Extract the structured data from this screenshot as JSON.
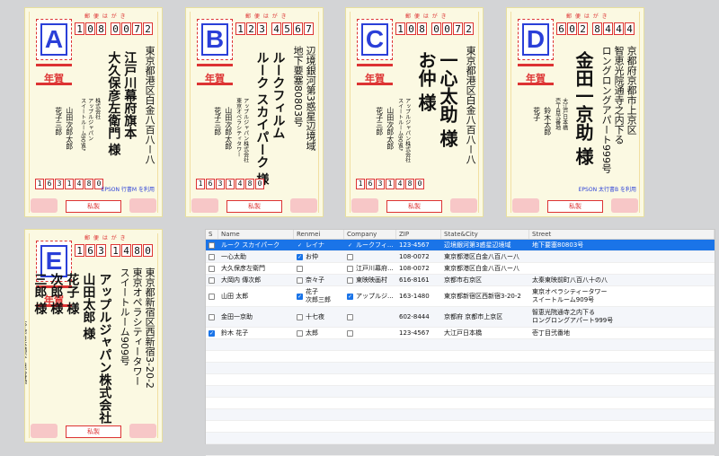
{
  "cards": [
    {
      "letter": "A",
      "zip": [
        "1",
        "0",
        "8",
        "0",
        "0",
        "7",
        "2"
      ],
      "address": [
        "東京都港区白金八百八ー八"
      ],
      "recipient": [
        "江戸川幕府旗本",
        "大久保彦左衛門 様"
      ],
      "company": [
        "株式会社",
        "アップルジャパン",
        "スイートルーム909号"
      ],
      "sender": [
        "山田",
        "花子",
        "次郎",
        "三郎",
        "太郎"
      ],
      "sender_zip": [
        "1",
        "6",
        "3",
        "1",
        "4",
        "8",
        "0"
      ],
      "note": "EPSON 行書M を利用"
    },
    {
      "letter": "B",
      "zip": [
        "1",
        "2",
        "3",
        "4",
        "5",
        "6",
        "7"
      ],
      "address": [
        "辺境銀河第3惑星辺境域",
        "地下要塞80803号"
      ],
      "recipient": [
        "ルークフィルム",
        "ルーク スカイパーク 様"
      ],
      "company": [
        "アップルジャパン株式会社",
        "東京オペラシティタワー"
      ],
      "sender": [
        "山田",
        "花子",
        "次郎",
        "三郎",
        "太郎"
      ],
      "sender_zip": [
        "1",
        "6",
        "3",
        "1",
        "4",
        "8",
        "0"
      ],
      "note": ""
    },
    {
      "letter": "C",
      "zip": [
        "1",
        "0",
        "8",
        "0",
        "0",
        "7",
        "2"
      ],
      "address": [
        "東京都港区白金八百八ー八"
      ],
      "recipient": [
        "一心太助 様",
        "お仲 様"
      ],
      "company": [
        "アップルジャパン株式会社",
        "スイートルーム909号"
      ],
      "sender": [
        "山田",
        "花子",
        "次郎",
        "三郎",
        "太郎"
      ],
      "sender_zip": [
        "1",
        "6",
        "3",
        "1",
        "4",
        "8",
        "0"
      ],
      "note": ""
    },
    {
      "letter": "D",
      "zip": [
        "6",
        "0",
        "2",
        "8",
        "4",
        "4",
        "4"
      ],
      "address": [
        "京都府京都市上京区",
        "智恵光院通寺之内下る",
        "ロングロングアパート999号"
      ],
      "recipient": [
        "金田一京助 様"
      ],
      "company": [
        "大江戸日本橋",
        "壱丁目弐番地"
      ],
      "sender": [
        "鈴木",
        "花子",
        "太郎"
      ],
      "sender_zip": [],
      "note": "EPSON 太行書B を利用"
    },
    {
      "letter": "E",
      "zip": [
        "1",
        "6",
        "3",
        "1",
        "4",
        "8",
        "0"
      ],
      "address": [
        "東京都新宿区西新宿3-20-2",
        "東京オペラシティータワー",
        "スイートルーム909号"
      ],
      "recipient": [
        "アップルジャパン株式会社",
        "山田太郎 様",
        "花子 様",
        "次郎 様",
        "三郎 様"
      ],
      "company": [
        "大江戸日本橋壱丁目弐番地"
      ],
      "sender": [
        "鈴木",
        "花子"
      ],
      "sender_zip": [],
      "note": ""
    }
  ],
  "card_labels": {
    "hagaki": "郵 便 は が き",
    "nenga": "年賀",
    "bottom": "私製"
  },
  "table": {
    "headers": [
      "S",
      "Name",
      "Renmei",
      "Company",
      "ZIP",
      "State&City",
      "Street"
    ],
    "rows": [
      {
        "s": false,
        "name": "ルーク スカイパーク",
        "rcb": true,
        "renmei": [
          "レイナ"
        ],
        "ccb": true,
        "company": "ルークフィ...",
        "zip": "123-4567",
        "state": "辺境銀河第3惑星辺境域",
        "street": [
          "地下要塞80803号"
        ],
        "sel": true
      },
      {
        "s": false,
        "name": "一心太助",
        "rcb": true,
        "renmei": [
          "お仲"
        ],
        "ccb": false,
        "company": "",
        "zip": "108-0072",
        "state": "東京都港区白金八百八ー八",
        "street": [
          ""
        ],
        "sel": false
      },
      {
        "s": false,
        "name": "大久保彦左衛門",
        "rcb": false,
        "renmei": [
          ""
        ],
        "ccb": false,
        "company": "江戸川幕府...",
        "zip": "108-0072",
        "state": "東京都港区白金八百八ー八",
        "street": [
          ""
        ],
        "sel": false
      },
      {
        "s": false,
        "name": "大岡内 傳次郎",
        "rcb": false,
        "renmei": [
          "奈々子"
        ],
        "ccb": false,
        "company": "東映映画村",
        "zip": "616-8161",
        "state": "京都市右京区",
        "street": [
          "太秦東映前町八百八十の八"
        ],
        "sel": false
      },
      {
        "s": false,
        "name": "山田 太郎",
        "rcb": true,
        "renmei": [
          "花子",
          "次郎三郎"
        ],
        "ccb": true,
        "company": "アップルジ...",
        "zip": "163-1480",
        "state": "東京都新宿区西新宿3-20-2",
        "street": [
          "東京オペラシティータワー",
          "スイートルーム909号"
        ],
        "sel": false
      },
      {
        "s": false,
        "name": "金田一京助",
        "rcb": false,
        "renmei": [
          "十七夜"
        ],
        "ccb": false,
        "company": "",
        "zip": "602-8444",
        "state": "京都府 京都市上京区",
        "street": [
          "智恵光院通寺之内下る",
          "ロングロングアパート999号"
        ],
        "sel": false
      },
      {
        "s": true,
        "name": "鈴木 花子",
        "rcb": false,
        "renmei": [
          "太郎"
        ],
        "ccb": false,
        "company": "",
        "zip": "123-4567",
        "state": "大江戸日本橋",
        "street": [
          "壱丁目弐番地"
        ],
        "sel": false
      }
    ]
  }
}
